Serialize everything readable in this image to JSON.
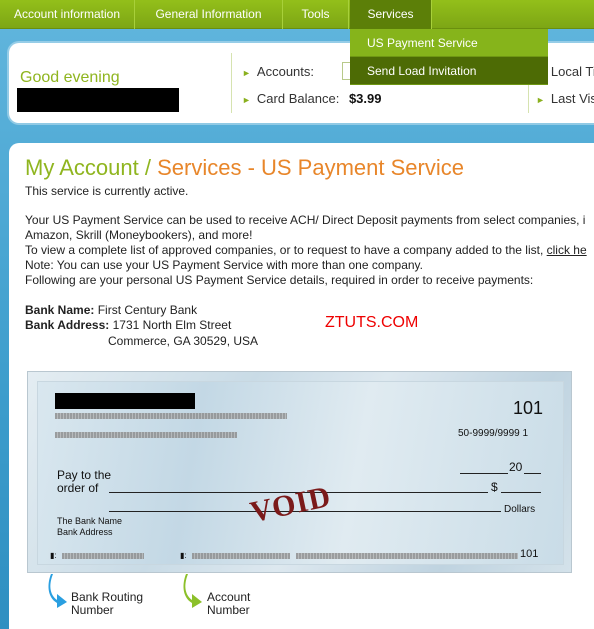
{
  "nav": {
    "tabs": [
      "Account information",
      "General Information",
      "Tools",
      "Services"
    ],
    "dropdown": [
      "US Payment Service",
      "Send Load Invitation"
    ]
  },
  "info": {
    "greeting": "Good evening",
    "accounts_label": "Accounts:",
    "balance_label": "Card Balance:",
    "balance_value": "$3.99",
    "local_time_label": "Local Tim",
    "last_visit_label": "Last Visi"
  },
  "page": {
    "title_a": "My Account",
    "title_sep": "/",
    "title_b": "Services - US Payment Service",
    "status": "This service is currently active.",
    "para1_line1": "Your US Payment Service can be used to receive ACH/ Direct Deposit payments from select companies, i",
    "para1_line2": "Amazon, Skrill (Moneybookers), and more!",
    "para2_text": "To view a complete list of approved companies, or to request to have a company added to the list,",
    "para2_link": "click he",
    "note": "Note: You can use your US Payment Service with more than one company.",
    "following": "Following are your personal US Payment Service details, required in order to receive payments:",
    "bank_name_label": "Bank Name:",
    "bank_name": "First Century Bank",
    "bank_address_label": "Bank Address:",
    "bank_address1": "1731 North Elm Street",
    "bank_address2": "Commerce, GA 30529, USA",
    "watermark": "ZTUTS.COM"
  },
  "check": {
    "check_number": "101",
    "fraction": "50-9999/9999 1",
    "date_suffix": "20",
    "pay_to_line1": "Pay to the",
    "pay_to_line2": "order of",
    "dollar_sign": "$",
    "dollars": "Dollars",
    "bank_name": "The Bank Name",
    "bank_address": "Bank Address",
    "void": "VOID",
    "micr_number": "101",
    "routing_label_1": "Bank Routing",
    "routing_label_2": "Number",
    "account_label_1": "Account",
    "account_label_2": "Number"
  },
  "colors": {
    "nav_green": "#8ab81a",
    "accent_orange": "#e8862a",
    "title_green": "#8fb51f",
    "background_blue": "#3d9dcc",
    "routing_arrow": "#2a9fe0",
    "account_arrow": "#8cc02a"
  }
}
